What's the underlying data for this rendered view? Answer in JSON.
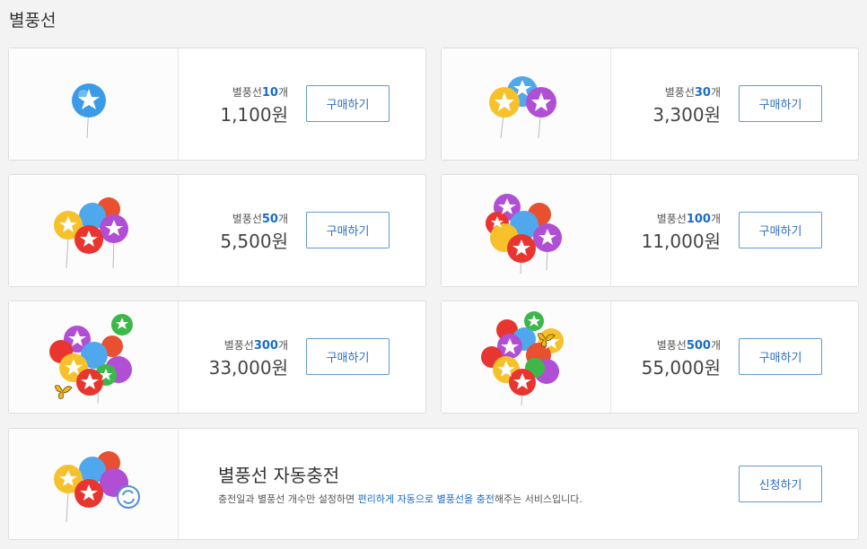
{
  "page": {
    "title": "별풍선"
  },
  "products": [
    {
      "prefix": "별풍선",
      "count": "10",
      "unit": "개",
      "price": "1,100원",
      "button": "구매하기",
      "icon": "balloon-1-icon"
    },
    {
      "prefix": "별풍선",
      "count": "30",
      "unit": "개",
      "price": "3,300원",
      "button": "구매하기",
      "icon": "balloon-3-icon"
    },
    {
      "prefix": "별풍선",
      "count": "50",
      "unit": "개",
      "price": "5,500원",
      "button": "구매하기",
      "icon": "balloon-bundle-icon"
    },
    {
      "prefix": "별풍선",
      "count": "100",
      "unit": "개",
      "price": "11,000원",
      "button": "구매하기",
      "icon": "balloon-bundle-large-icon"
    },
    {
      "prefix": "별풍선",
      "count": "300",
      "unit": "개",
      "price": "33,000원",
      "button": "구매하기",
      "icon": "balloon-bundle-butterfly-icon"
    },
    {
      "prefix": "별풍선",
      "count": "500",
      "unit": "개",
      "price": "55,000원",
      "button": "구매하기",
      "icon": "balloon-bundle-huge-icon"
    }
  ],
  "auto_charge": {
    "title": "별풍선 자동충전",
    "desc_pre": "충전일과 별풍선 개수만 설정하면 ",
    "desc_hl1": "편리하게 자동으로 별풍선을 충전",
    "desc_post": "해주는 서비스입니다.",
    "button": "신청하기",
    "icon": "auto-charge-balloon-icon"
  },
  "colors": {
    "accent": "#1a6bc9",
    "button_border": "#5f9ad8",
    "background": "#f3f3f3"
  }
}
